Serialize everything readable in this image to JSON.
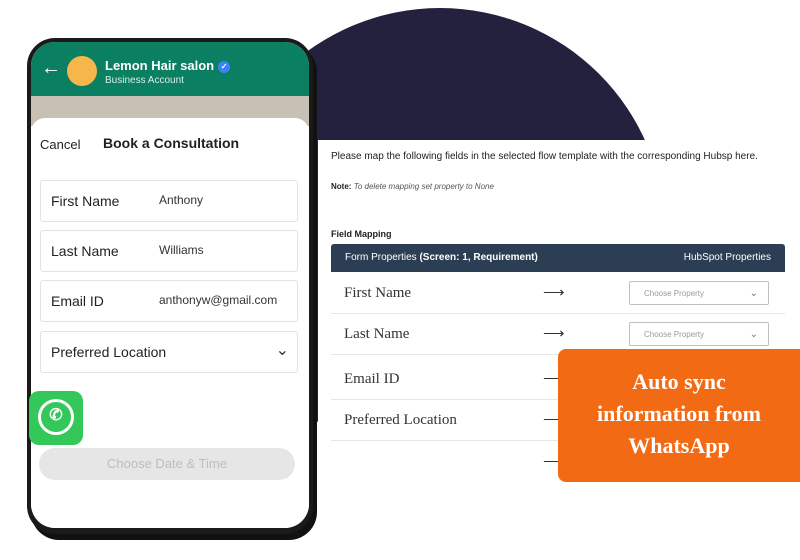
{
  "phone": {
    "back_icon": "back-arrow-icon",
    "business_name": "Lemon Hair salon",
    "business_sub": "Business Account",
    "verified_icon": "verified-badge-icon",
    "cancel_label": "Cancel",
    "sheet_title": "Book a Consultation",
    "fields": [
      {
        "label": "First Name",
        "value": "Anthony"
      },
      {
        "label": "Last Name",
        "value": "Williams"
      },
      {
        "label": "Email ID",
        "value": "anthonyw@gmail.com"
      }
    ],
    "location_label": "Preferred Location",
    "chevron_icon": "chevron-down-icon",
    "choose_button": "Choose Date & Time",
    "whatsapp_icon": "whatsapp-logo-icon"
  },
  "mapping": {
    "intro": "Please map the following fields in the selected flow template with the corresponding Hubsp here.",
    "note_label": "Note:",
    "note_text": "To delete mapping set property to None",
    "section_title": "Field Mapping",
    "header_left_prefix": "Form Properties",
    "header_left_bold": "(Screen: 1, Requirement)",
    "header_right": "HubSpot Properties",
    "rows": [
      {
        "label": "First Name",
        "arrow": "⟶",
        "dropdown": "Choose Property"
      },
      {
        "label": "Last Name",
        "arrow": "⟶",
        "dropdown": "Choose Property"
      },
      {
        "label": "Email ID",
        "arrow": "⟶",
        "dropdown": ""
      },
      {
        "label": "Preferred Location",
        "arrow": "⟶",
        "dropdown": ""
      },
      {
        "label": "",
        "arrow": "⟶",
        "dropdown": ""
      }
    ]
  },
  "callout": {
    "line1": "Auto sync",
    "line2": "information from",
    "line3": "WhatsApp"
  },
  "colors": {
    "whatsapp_green": "#0b7f61",
    "background_circle": "#24213f",
    "table_header": "#2c3e53",
    "callout": "#f36a15"
  }
}
